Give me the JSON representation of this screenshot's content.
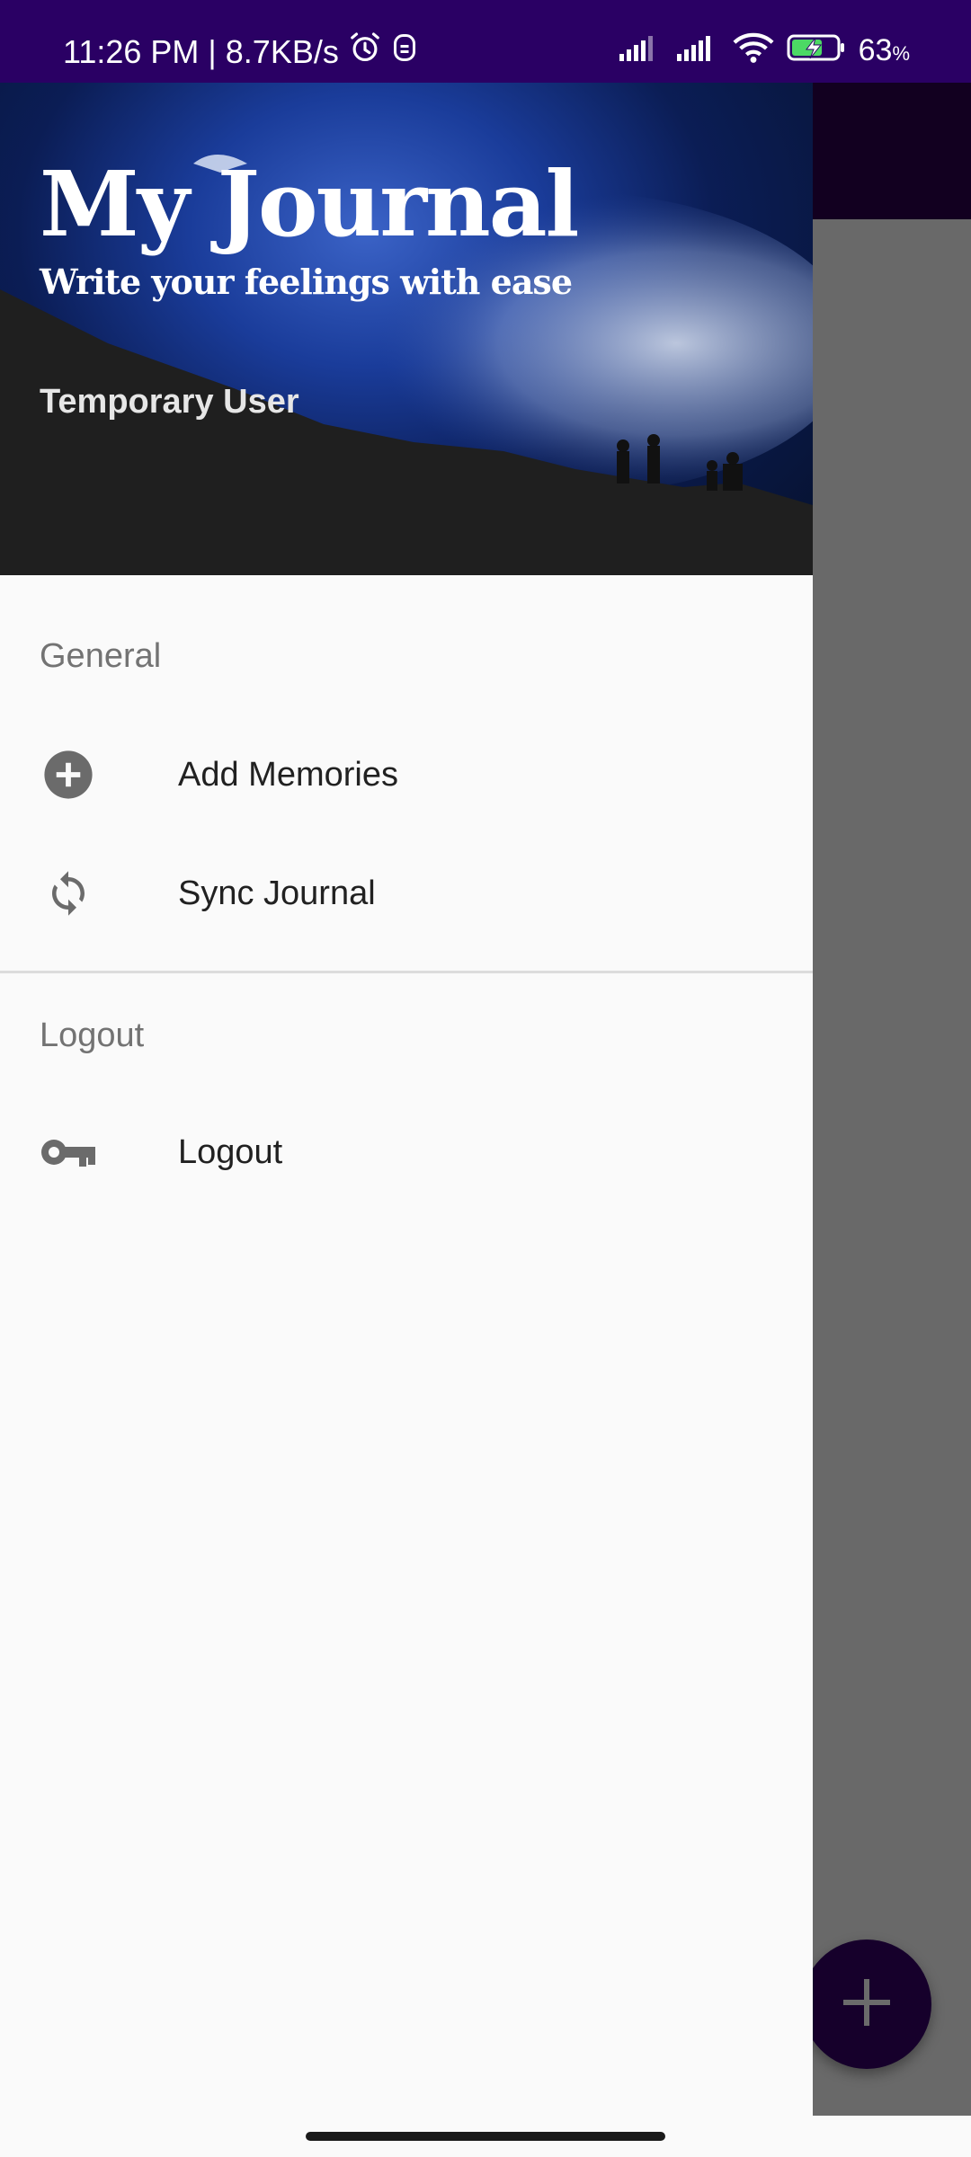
{
  "status_bar": {
    "time_speed": "11:26 PM | 8.7KB/s",
    "battery": "63",
    "battery_unit": "%",
    "icons": [
      "alarm-icon",
      "notification-icon",
      "signal-icon",
      "signal-icon",
      "wifi-icon",
      "battery-charging-icon"
    ]
  },
  "drawer": {
    "header": {
      "title": "My Journal",
      "subtitle": "Write your feelings with ease",
      "user": "Temporary User"
    },
    "sections": [
      {
        "label": "General",
        "items": [
          {
            "label": "Add Memories",
            "icon": "add-circle-icon"
          },
          {
            "label": "Sync Journal",
            "icon": "sync-icon"
          }
        ]
      },
      {
        "label": "Logout",
        "items": [
          {
            "label": "Logout",
            "icon": "key-icon"
          }
        ]
      }
    ]
  },
  "fab": {
    "icon": "plus-icon"
  },
  "colors": {
    "status_bar": "#2a0064",
    "drawer_bg": "#fafafa",
    "scrim": "#696969",
    "fab": "#16002b",
    "icon_gray": "#6b6b6b"
  }
}
